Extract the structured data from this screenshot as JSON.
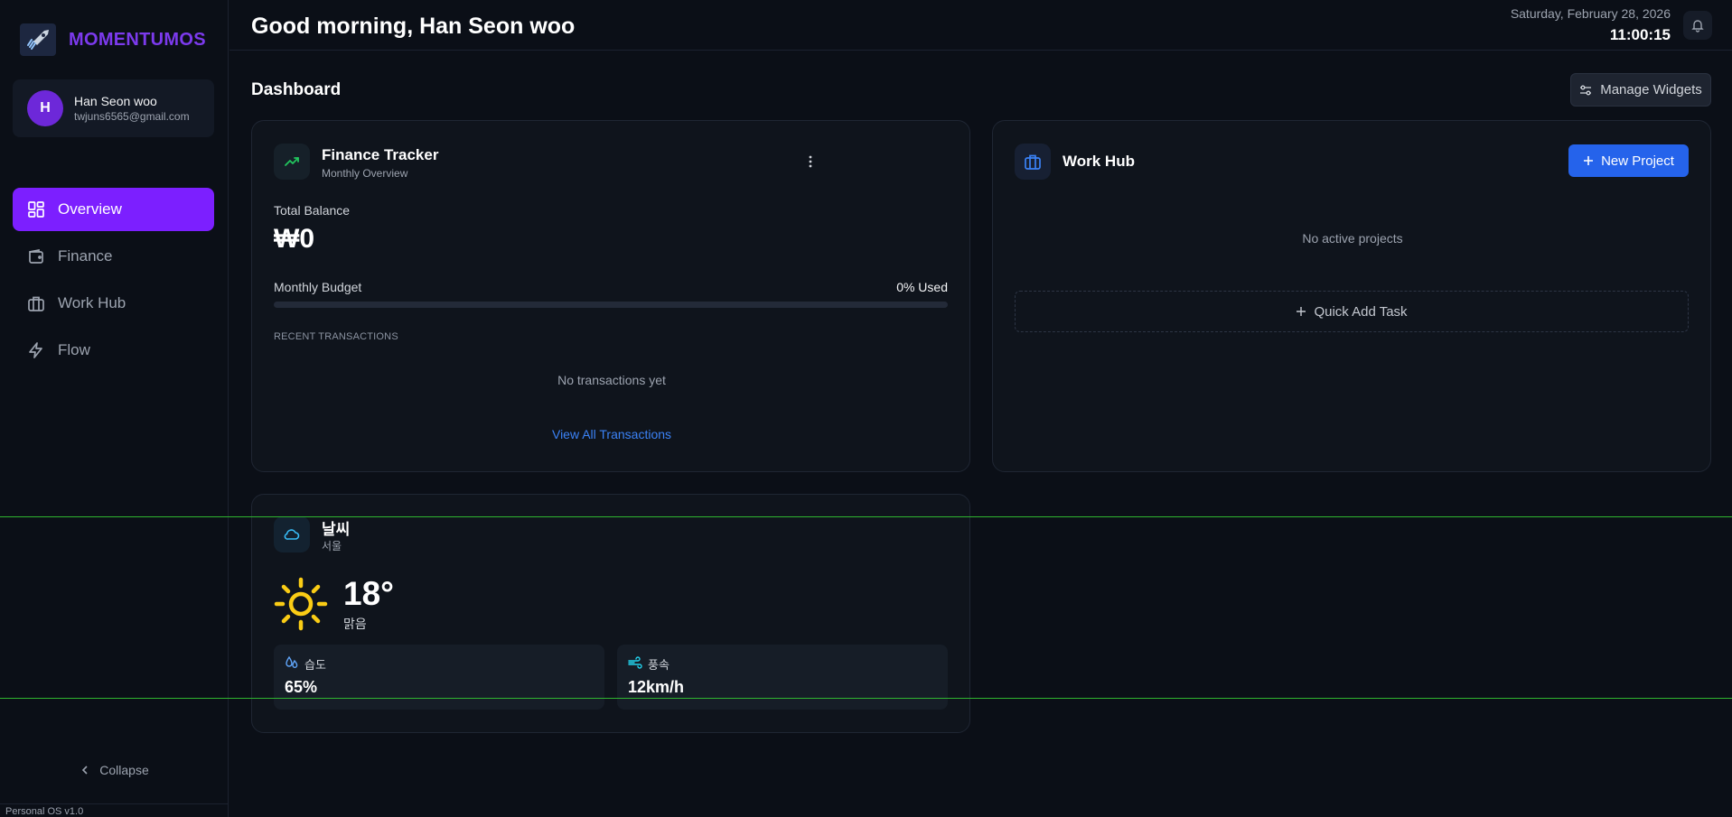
{
  "sidebar": {
    "brand": "MOMENTUMOS",
    "user": {
      "initial": "H",
      "name": "Han Seon woo",
      "email": "twjuns6565@gmail.com"
    },
    "nav": [
      {
        "label": "Overview",
        "icon": "grid-icon",
        "active": true
      },
      {
        "label": "Finance",
        "icon": "wallet-icon",
        "active": false
      },
      {
        "label": "Work Hub",
        "icon": "briefcase-icon",
        "active": false
      },
      {
        "label": "Flow",
        "icon": "lightning-icon",
        "active": false
      }
    ],
    "collapse_label": "Collapse",
    "version": "Personal OS v1.0"
  },
  "header": {
    "greeting": "Good morning, Han Seon woo",
    "date": "Saturday, February 28, 2026",
    "time": "11:00:15"
  },
  "dashboard": {
    "title": "Dashboard",
    "manage_widgets_label": "Manage Widgets",
    "finance": {
      "title": "Finance Tracker",
      "subtitle": "Monthly Overview",
      "total_balance_label": "Total Balance",
      "total_balance": "₩0",
      "budget_label": "Monthly Budget",
      "budget_used": "0% Used",
      "budget_fraction": 0,
      "recent_label": "RECENT TRANSACTIONS",
      "empty_text": "No transactions yet",
      "view_all_label": "View All Transactions"
    },
    "workhub": {
      "title": "Work Hub",
      "new_project_label": "New Project",
      "empty_text": "No active projects",
      "quick_add_label": "Quick Add Task"
    },
    "weather": {
      "title": "날씨",
      "location": "서울",
      "temperature": "18°",
      "condition": "맑음",
      "humidity_label": "습도",
      "humidity_value": "65%",
      "wind_label": "풍속",
      "wind_value": "12km/h"
    }
  },
  "colors": {
    "accent": "#7c1fff",
    "brand": "#7c3aed",
    "primary_button": "#2563eb",
    "link": "#3b82f6",
    "sun": "#facc15"
  }
}
